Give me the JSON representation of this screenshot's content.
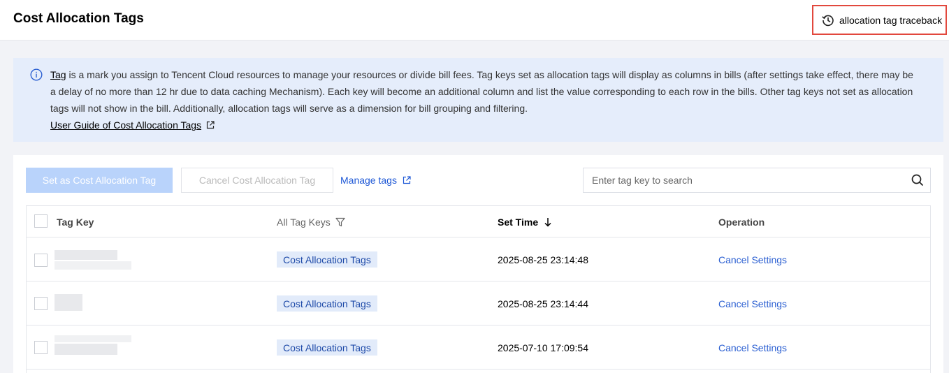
{
  "header": {
    "title": "Cost Allocation Tags",
    "traceback_label": "allocation tag traceback",
    "traceback_icon": "history-icon"
  },
  "info": {
    "icon": "info-circle-icon",
    "tag_link": "Tag",
    "text": " is a mark you assign to Tencent Cloud resources to manage your resources or divide bill fees. Tag keys set as allocation tags will display as columns in bills (after settings take effect, there may be a delay of no more than 12 hr due to data caching Mechanism). Each key will become an additional column and list the value corresponding to each row in the bills. Other tag keys not set as allocation tags will not show in the bill. Additionally, allocation tags will serve as a dimension for bill grouping and filtering.",
    "guide_link": "User Guide of Cost Allocation Tags",
    "guide_icon": "external-link-icon"
  },
  "toolbar": {
    "set_button": "Set as Cost Allocation Tag",
    "cancel_button": "Cancel Cost Allocation Tag",
    "manage_link": "Manage tags",
    "manage_icon": "external-link-icon",
    "search_placeholder": "Enter tag key to search",
    "search_icon": "search-icon"
  },
  "table": {
    "columns": {
      "tag_key": "Tag Key",
      "all_tag_keys": "All Tag Keys",
      "set_time": "Set Time",
      "operation": "Operation"
    },
    "filter_icon": "filter-icon",
    "sort_icon": "arrow-down-icon",
    "rows": [
      {
        "tag_key": "",
        "type": "Cost Allocation Tags",
        "set_time": "2025-08-25 23:14:48",
        "operation": "Cancel Settings"
      },
      {
        "tag_key": "",
        "type": "Cost Allocation Tags",
        "set_time": "2025-08-25 23:14:44",
        "operation": "Cancel Settings"
      },
      {
        "tag_key": "",
        "type": "Cost Allocation Tags",
        "set_time": "2025-07-10 17:09:54",
        "operation": "Cancel Settings"
      }
    ]
  },
  "colors": {
    "accent": "#1e58d6",
    "highlight_border": "#e2483d",
    "info_bg": "#e5edfb",
    "disabled_primary": "#b9d3fb"
  }
}
